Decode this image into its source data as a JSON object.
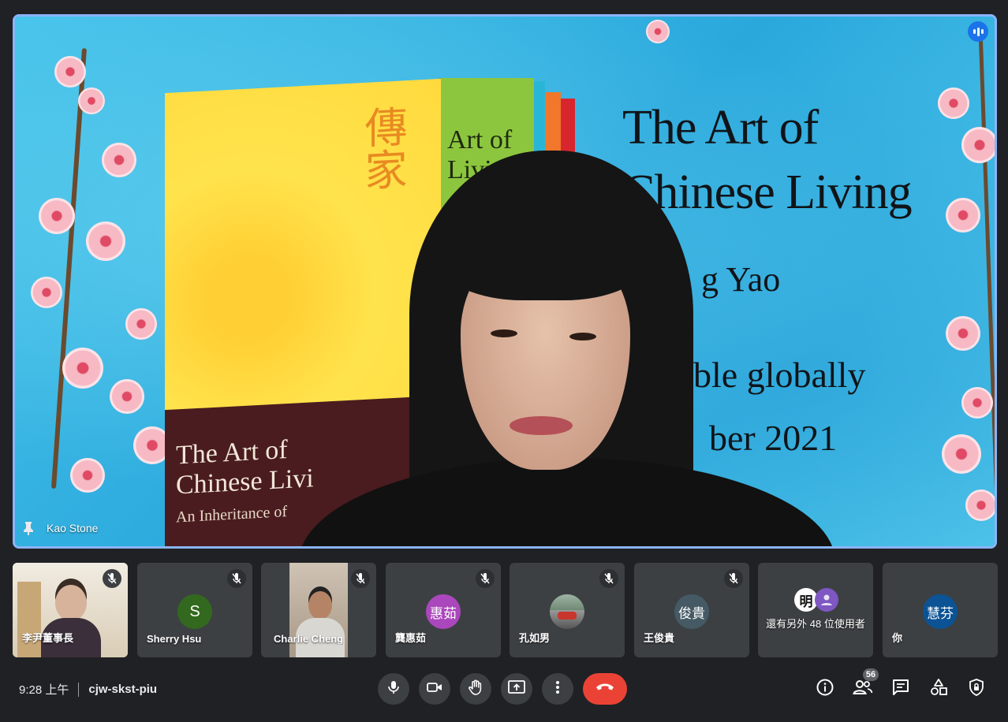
{
  "main_speaker": {
    "name": "Kao Stone",
    "poster": {
      "title_line1": "The Art of",
      "title_line2": "Chinese Living",
      "line3": "g Yao",
      "line4": "ble globally",
      "line5": "ber 2021"
    },
    "book_front": {
      "hanzi": "傳家",
      "title_line1": "The Art of",
      "title_line2": "Chinese Livi",
      "subtitle": "An Inheritance of"
    },
    "book_green": {
      "title_line1": "Art of",
      "title_line2": "Livin"
    }
  },
  "participants": [
    {
      "name": "李尹董事長",
      "type": "video",
      "muted": true
    },
    {
      "name": "Sherry Hsu",
      "type": "avatar",
      "initial": "S",
      "color": "#33691e",
      "muted": true
    },
    {
      "name": "Charlie Cheng",
      "type": "video",
      "muted": true
    },
    {
      "name": "龔惠茹",
      "type": "avatar",
      "initial": "惠茹",
      "color": "#ab47bc",
      "muted": true
    },
    {
      "name": "孔如男",
      "type": "photo",
      "muted": true
    },
    {
      "name": "王俊貴",
      "type": "avatar",
      "initial": "俊貴",
      "color": "#455a64",
      "muted": true
    },
    {
      "name": "還有另外 48 位使用者",
      "type": "others",
      "muted": false,
      "avatar1": "明"
    },
    {
      "name": "你",
      "type": "avatar",
      "initial": "慧芬",
      "color": "#0b5394",
      "muted": false
    }
  ],
  "meeting": {
    "time": "9:28 上午",
    "code": "cjw-skst-piu",
    "participant_count": "56"
  },
  "colors": {
    "background": "#202124",
    "tile": "#3c4043",
    "active_speaker_border": "#8ab4f8",
    "end_call": "#ea4335",
    "accent": "#1a73e8"
  },
  "icons": {
    "controls": [
      "mic-icon",
      "camera-icon",
      "raise-hand-icon",
      "present-icon",
      "more-options-icon",
      "end-call-icon"
    ],
    "side": [
      "info-icon",
      "people-icon",
      "chat-icon",
      "activities-icon",
      "host-controls-icon"
    ]
  }
}
